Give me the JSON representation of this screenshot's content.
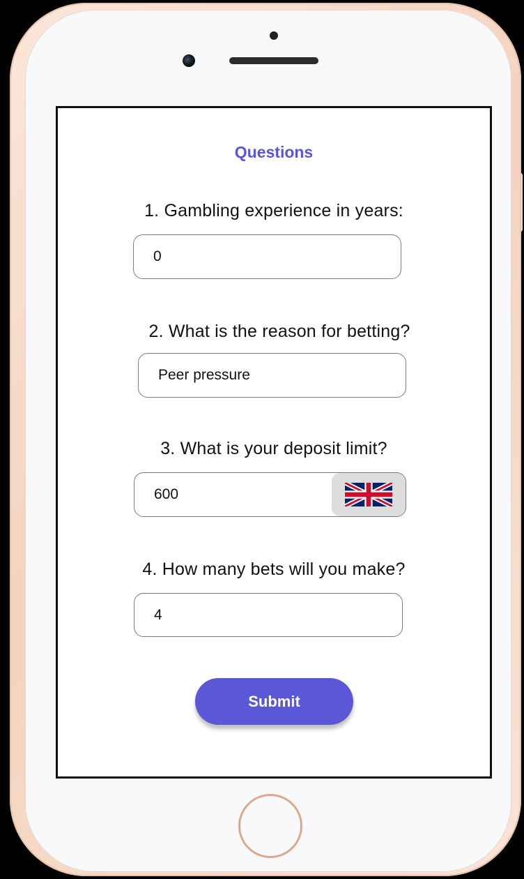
{
  "form": {
    "title": "Questions",
    "questions": [
      {
        "label": "1. Gambling experience in years:",
        "value": "0"
      },
      {
        "label": "2. What is the reason for betting?",
        "value": "Peer pressure"
      },
      {
        "label": "3. What is your deposit limit?",
        "value": "600",
        "currency_icon": "uk-flag-icon"
      },
      {
        "label": "4. How many bets will you make?",
        "value": "4"
      }
    ],
    "submit_label": "Submit"
  },
  "colors": {
    "accent": "#5b58d7",
    "title": "#5a55d9"
  }
}
